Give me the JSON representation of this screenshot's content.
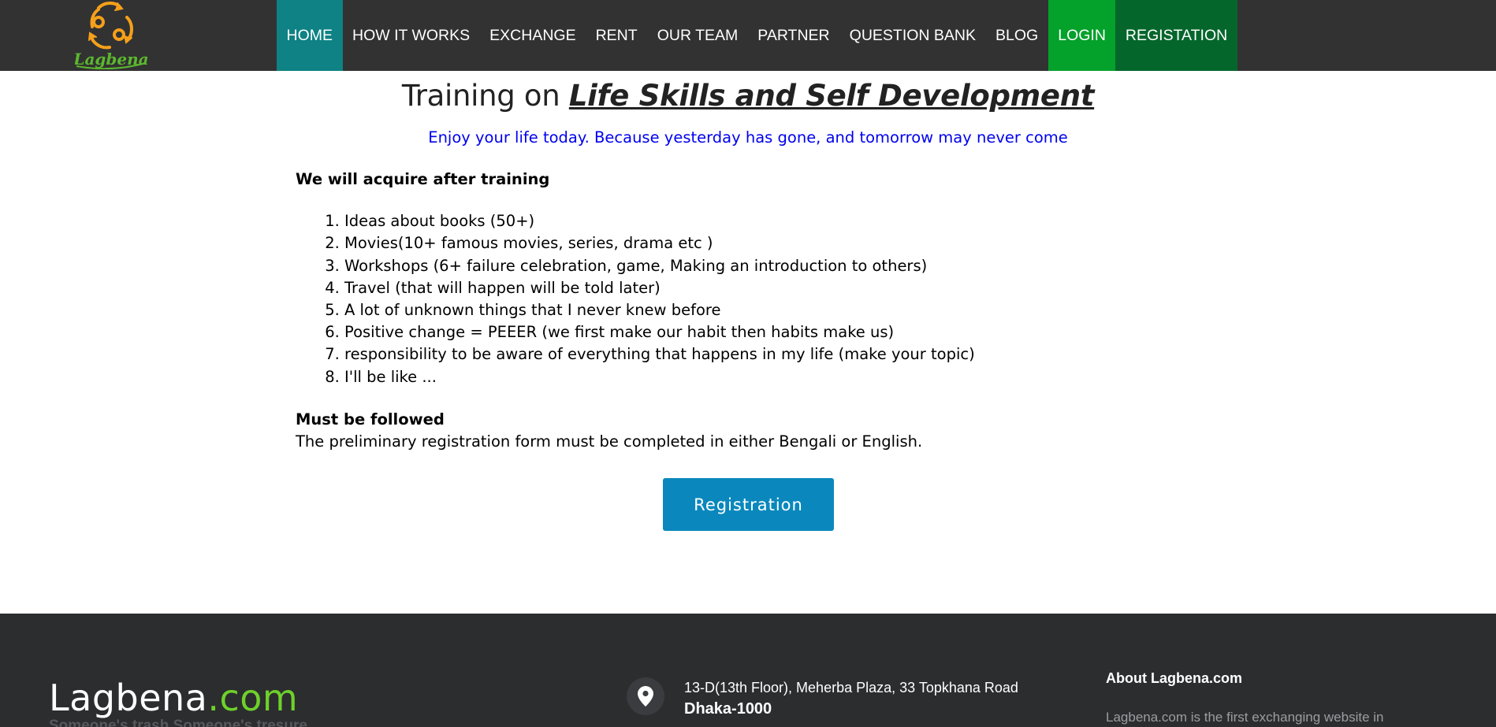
{
  "header": {
    "logo_text": "Lagbena",
    "nav": [
      {
        "label": "HOME"
      },
      {
        "label": "HOW IT WORKS"
      },
      {
        "label": "EXCHANGE"
      },
      {
        "label": "RENT"
      },
      {
        "label": "OUR TEAM"
      },
      {
        "label": "PARTNER"
      },
      {
        "label": "QUESTION BANK"
      },
      {
        "label": "BLOG"
      },
      {
        "label": "LOGIN"
      },
      {
        "label": "REGISTATION"
      }
    ]
  },
  "main": {
    "title_prefix": "Training on ",
    "title_emphasis": "Life Skills and Self Development",
    "tagline": "Enjoy your life today. Because yesterday has gone, and tomorrow may never come",
    "acquire_heading": "We will acquire after training",
    "acquire_items": [
      "Ideas about books (50+)",
      "Movies(10+ famous movies, series, drama etc )",
      "Workshops (6+ failure celebration, game, Making an introduction to others)",
      "Travel (that will happen will be told later)",
      "A lot of unknown things that I never knew before",
      "Positive change = PEEER (we first make our habit then habits make us)",
      "responsibility to be aware of everything that happens in my life (make your topic)",
      "I'll be like ..."
    ],
    "follow_heading": "Must be followed",
    "follow_text": "The preliminary registration form must be completed in either Bengali or English.",
    "registration_button": "Registration"
  },
  "footer": {
    "brand_name": "Lagbena",
    "brand_tld": ".com",
    "brand_tagline": "Someone's trash Someone's tresure",
    "address_line": "13-D(13th Floor), Meherba Plaza, 33 Topkhana Road",
    "city": "Dhaka-1000",
    "about_title": "About Lagbena.com",
    "about_text": "Lagbena.com is the first exchanging website in"
  },
  "colors": {
    "nav_bg": "#323232",
    "home_active": "#0e8284",
    "login_bg": "#04a12b",
    "register_bg": "#05662c",
    "button_bg": "#0a88bd",
    "tagline": "#0000ee",
    "footer_bg": "#2c2d2f",
    "brand_accent": "#6ed12a",
    "logo_orange": "#f5a01a",
    "logo_green": "#5cb82e"
  },
  "icons": {
    "logo": "recycle-arrows-icon",
    "location": "map-pin-icon"
  }
}
